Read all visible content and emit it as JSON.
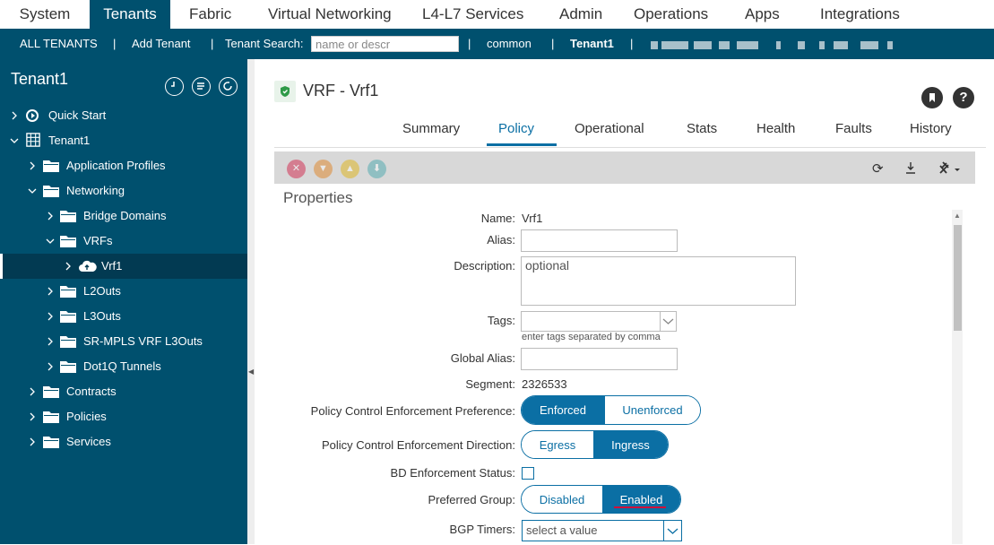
{
  "topnav": {
    "tabs": [
      "System",
      "Tenants",
      "Fabric",
      "Virtual Networking",
      "L4-L7 Services",
      "Admin",
      "Operations",
      "Apps",
      "Integrations"
    ],
    "active": "Tenants"
  },
  "subnav": {
    "all_tenants": "ALL TENANTS",
    "add_tenant": "Add Tenant",
    "search_label": "Tenant Search:",
    "search_placeholder": "name or descr",
    "common": "common",
    "current": "Tenant1",
    "separator": "|"
  },
  "sidebar": {
    "title": "Tenant1",
    "items": [
      {
        "label": "Quick Start",
        "icon": "quick-start-icon"
      },
      {
        "label": "Tenant1",
        "icon": "tenant-building-icon"
      },
      {
        "label": "Application Profiles",
        "icon": "folder-icon"
      },
      {
        "label": "Networking",
        "icon": "folder-icon"
      },
      {
        "label": "Bridge Domains",
        "icon": "folder-icon"
      },
      {
        "label": "VRFs",
        "icon": "folder-icon"
      },
      {
        "label": "Vrf1",
        "icon": "cloud-icon"
      },
      {
        "label": "L2Outs",
        "icon": "folder-icon"
      },
      {
        "label": "L3Outs",
        "icon": "folder-icon"
      },
      {
        "label": "SR-MPLS VRF L3Outs",
        "icon": "folder-icon"
      },
      {
        "label": "Dot1Q Tunnels",
        "icon": "folder-icon"
      },
      {
        "label": "Contracts",
        "icon": "folder-icon"
      },
      {
        "label": "Policies",
        "icon": "folder-icon"
      },
      {
        "label": "Services",
        "icon": "folder-icon"
      }
    ]
  },
  "main": {
    "title": "VRF - Vrf1",
    "tabs": [
      "Summary",
      "Policy",
      "Operational",
      "Stats",
      "Health",
      "Faults",
      "History"
    ],
    "active_tab": "Policy",
    "section_title": "Properties",
    "fields": {
      "name_label": "Name:",
      "name_value": "Vrf1",
      "alias_label": "Alias:",
      "alias_value": "",
      "description_label": "Description:",
      "description_placeholder": "optional",
      "tags_label": "Tags:",
      "tags_hint": "enter tags separated by comma",
      "global_alias_label": "Global Alias:",
      "segment_label": "Segment:",
      "segment_value": "2326533",
      "pce_pref_label": "Policy Control Enforcement Preference:",
      "pce_pref_options": [
        "Enforced",
        "Unenforced"
      ],
      "pce_pref_selected": "Enforced",
      "pce_dir_label": "Policy Control Enforcement Direction:",
      "pce_dir_options": [
        "Egress",
        "Ingress"
      ],
      "pce_dir_selected": "Ingress",
      "bd_enf_label": "BD Enforcement Status:",
      "pref_group_label": "Preferred Group:",
      "pref_group_options": [
        "Disabled",
        "Enabled"
      ],
      "pref_group_selected": "Enabled",
      "bgp_timers_label": "BGP Timers:",
      "bgp_timers_placeholder": "select a value"
    }
  },
  "colors": {
    "nav_dark": "#00506e",
    "accent": "#0b6fa4",
    "highlight_underline": "#d0103a"
  }
}
